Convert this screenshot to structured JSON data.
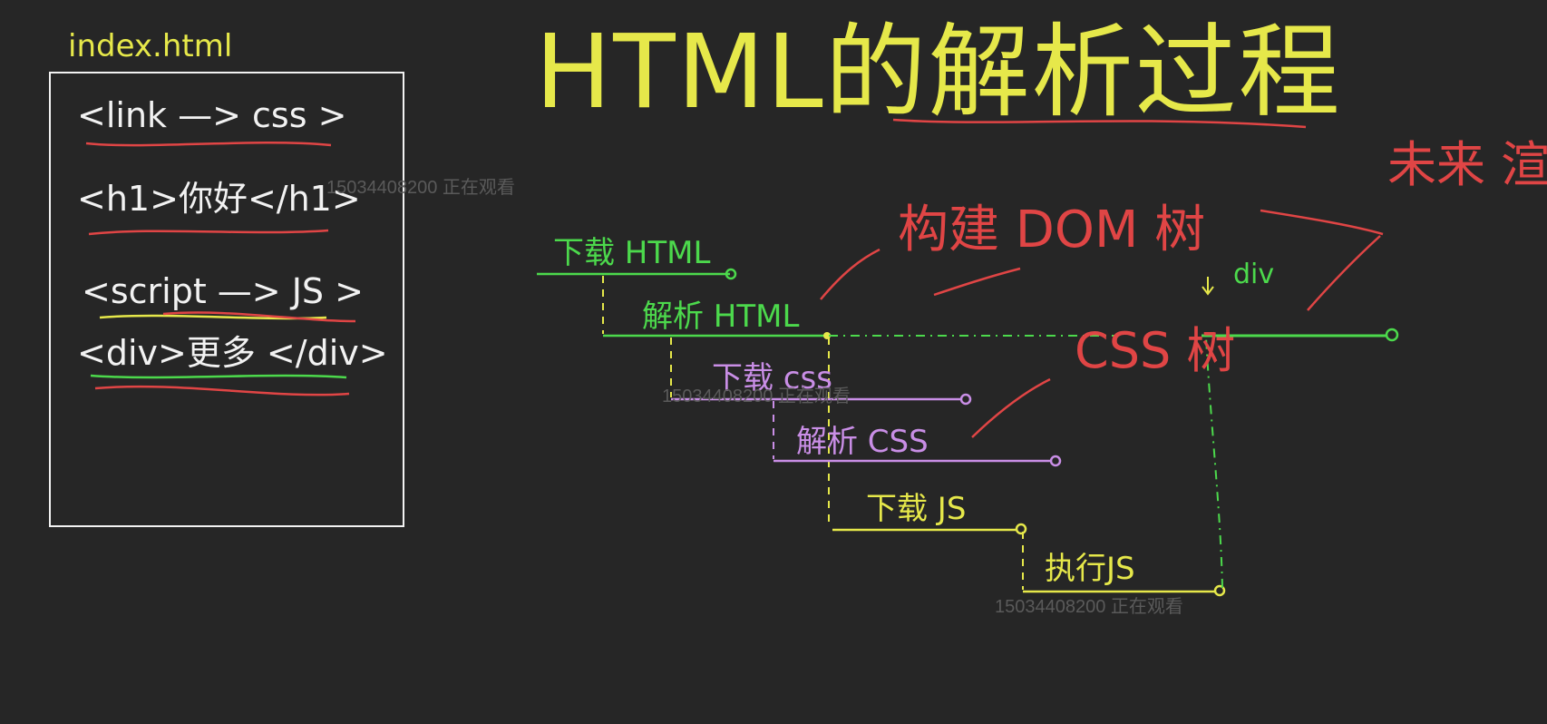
{
  "colors": {
    "background": "#262626",
    "white": "#f2f2f2",
    "yellow": "#e6e84a",
    "green": "#4cd94c",
    "purple": "#c98ee6",
    "red": "#e04545",
    "watermark": "#5a5a5a"
  },
  "title": "HTML的解析过程",
  "file": {
    "name": "index.html",
    "lines": [
      "<link —> css >",
      "<h1>你好</h1>",
      "<script —> JS >",
      "<div>更多 </div>"
    ]
  },
  "timeline": {
    "steps": [
      {
        "label": "下载 HTML",
        "color": "green"
      },
      {
        "label": "解析 HTML",
        "color": "green"
      },
      {
        "label": "下载 css",
        "color": "purple"
      },
      {
        "label": "解析 CSS",
        "color": "purple"
      },
      {
        "label": "下载 JS",
        "color": "yellow"
      },
      {
        "label": "执行JS",
        "color": "yellow"
      }
    ]
  },
  "annotations": {
    "dom_tree": "构建 DOM 树",
    "cssom_tree": "CSS 树",
    "div": "div",
    "render": "未来 渲染"
  },
  "watermarks": [
    "15034408200 正在观看",
    "15034408200 正在观看",
    "15034408200 正在观看"
  ]
}
